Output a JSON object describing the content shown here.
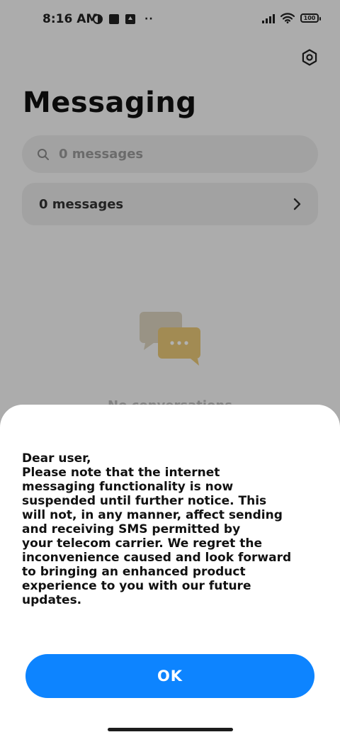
{
  "status_bar": {
    "time": "8:16 AM",
    "dots": "··",
    "battery": "100"
  },
  "app": {
    "title": "Messaging",
    "search_placeholder": "0 messages",
    "messages_row_label": "0 messages",
    "empty_text": "No conversations"
  },
  "dialog": {
    "message_lines": [
      "Dear user,",
      "Please note that the internet",
      "messaging functionality is now",
      "suspended until further notice. This",
      "will not, in any manner, affect sending",
      "and receiving SMS permitted by",
      "your telecom carrier. We regret the",
      "inconvenience caused and look forward",
      "to bringing an enhanced product",
      "experience to you with our future",
      "updates."
    ],
    "ok_label": "OK"
  },
  "colors": {
    "accent": "#0d84ff",
    "overlay": "rgba(0,0,0,0.30)",
    "illustration_back": "#dbd3bf",
    "illustration_front": "#e8c877"
  },
  "icons": {
    "settings": "gear-icon",
    "search": "search-icon",
    "chevron": "chevron-right-icon",
    "empty": "chat-bubbles-icon"
  }
}
